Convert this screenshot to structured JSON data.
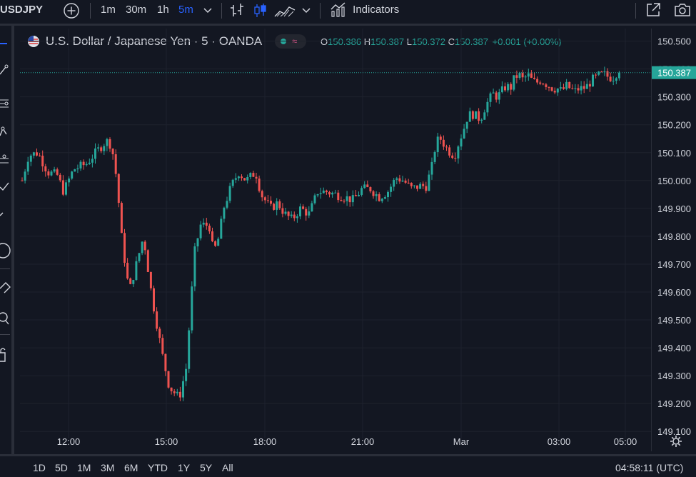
{
  "toolbar": {
    "symbol": "USDJPY",
    "intervals": [
      "1m",
      "30m",
      "1h",
      "5m"
    ],
    "active_interval": "5m",
    "indicators_label": "Indicators"
  },
  "legend": {
    "title": "U.S. Dollar / Japanese Yen · 5 · OANDA",
    "o_label": "O",
    "o_value": "150.386",
    "h_label": "H",
    "h_value": "150.387",
    "l_label": "L",
    "l_value": "150.372",
    "c_label": "C",
    "c_value": "150.387",
    "change": "+0.001 (+0.00%)"
  },
  "colors": {
    "up": "#26a69a",
    "down": "#ef5350",
    "active": "#2962ff",
    "background": "#131722"
  },
  "chart_data": {
    "type": "candlestick",
    "x": [
      "12:00",
      "15:00",
      "18:00",
      "21:00",
      "Mar",
      "03:00",
      "05:00"
    ],
    "y_ticks": [
      "150.500",
      "150.400",
      "150.300",
      "150.200",
      "150.100",
      "150.000",
      "149.900",
      "149.800",
      "149.700",
      "149.600",
      "149.500",
      "149.400",
      "149.300",
      "149.200",
      "149.100"
    ],
    "ylim": [
      149.075,
      150.545
    ],
    "last_price": "150.387",
    "path": [
      [
        0,
        150.0
      ],
      [
        9,
        150.09
      ],
      [
        22,
        150.1
      ],
      [
        36,
        150.03
      ],
      [
        49,
        150.02
      ],
      [
        58,
        149.96
      ],
      [
        72,
        150.04
      ],
      [
        90,
        150.06
      ],
      [
        103,
        150.1
      ],
      [
        117,
        150.14
      ],
      [
        122,
        150.14
      ],
      [
        129,
        150.08
      ],
      [
        135,
        149.93
      ],
      [
        140,
        149.78
      ],
      [
        150,
        149.6
      ],
      [
        162,
        149.72
      ],
      [
        170,
        149.8
      ],
      [
        182,
        149.58
      ],
      [
        196,
        149.38
      ],
      [
        206,
        149.26
      ],
      [
        220,
        149.22
      ],
      [
        230,
        149.33
      ],
      [
        236,
        149.55
      ],
      [
        242,
        149.75
      ],
      [
        250,
        149.84
      ],
      [
        262,
        149.84
      ],
      [
        268,
        149.74
      ],
      [
        276,
        149.8
      ],
      [
        282,
        149.9
      ],
      [
        293,
        149.98
      ],
      [
        303,
        150.03
      ],
      [
        314,
        150.0
      ],
      [
        327,
        150.03
      ],
      [
        335,
        149.95
      ],
      [
        348,
        149.9
      ],
      [
        358,
        149.92
      ],
      [
        368,
        149.88
      ],
      [
        378,
        149.86
      ],
      [
        390,
        149.9
      ],
      [
        402,
        149.88
      ],
      [
        414,
        149.96
      ],
      [
        426,
        149.96
      ],
      [
        440,
        149.95
      ],
      [
        452,
        149.94
      ],
      [
        464,
        149.93
      ],
      [
        476,
        149.97
      ],
      [
        488,
        149.97
      ],
      [
        500,
        149.94
      ],
      [
        512,
        149.96
      ],
      [
        524,
        150.01
      ],
      [
        534,
        150.0
      ],
      [
        546,
        149.97
      ],
      [
        556,
        149.98
      ],
      [
        566,
        149.98
      ],
      [
        574,
        150.05
      ],
      [
        580,
        150.14
      ],
      [
        587,
        150.15
      ],
      [
        593,
        150.12
      ],
      [
        600,
        150.1
      ],
      [
        606,
        150.09
      ],
      [
        612,
        150.14
      ],
      [
        618,
        150.18
      ],
      [
        624,
        150.23
      ],
      [
        630,
        150.24
      ],
      [
        636,
        150.23
      ],
      [
        642,
        150.22
      ],
      [
        648,
        150.26
      ],
      [
        654,
        150.29
      ],
      [
        660,
        150.31
      ],
      [
        666,
        150.3
      ],
      [
        672,
        150.32
      ],
      [
        678,
        150.34
      ],
      [
        684,
        150.33
      ],
      [
        690,
        150.37
      ],
      [
        696,
        150.38
      ],
      [
        702,
        150.36
      ],
      [
        708,
        150.38
      ],
      [
        714,
        150.36
      ],
      [
        720,
        150.35
      ],
      [
        726,
        150.36
      ],
      [
        732,
        150.35
      ],
      [
        738,
        150.34
      ],
      [
        744,
        150.33
      ],
      [
        750,
        150.33
      ],
      [
        756,
        150.32
      ],
      [
        762,
        150.34
      ],
      [
        768,
        150.33
      ],
      [
        774,
        150.32
      ],
      [
        780,
        150.33
      ],
      [
        786,
        150.33
      ],
      [
        792,
        150.34
      ],
      [
        798,
        150.36
      ],
      [
        804,
        150.37
      ],
      [
        810,
        150.38
      ],
      [
        816,
        150.38
      ],
      [
        822,
        150.37
      ],
      [
        828,
        150.37
      ],
      [
        834,
        150.39
      ],
      [
        840,
        150.387
      ]
    ]
  },
  "time_scale": {
    "ranges": [
      "1D",
      "5D",
      "1M",
      "3M",
      "6M",
      "YTD",
      "1Y",
      "5Y",
      "All"
    ],
    "clock": "04:58:11 (UTC)"
  }
}
